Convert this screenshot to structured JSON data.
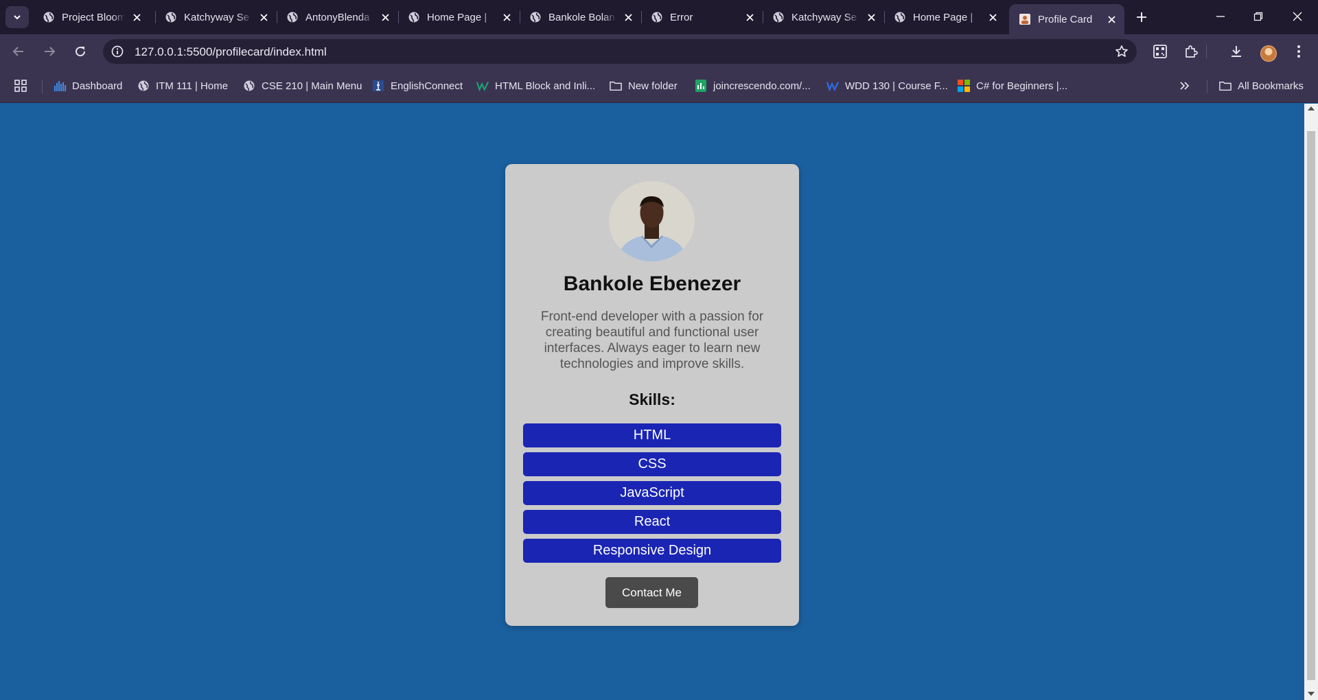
{
  "browser": {
    "tabs": [
      {
        "title": "Project Bloom",
        "active": false
      },
      {
        "title": "Katchyway Se",
        "active": false
      },
      {
        "title": "AntonyBlenda",
        "active": false
      },
      {
        "title": "Home Page |",
        "active": false
      },
      {
        "title": "Bankole Bolan",
        "active": false
      },
      {
        "title": "Error",
        "active": false
      },
      {
        "title": "Katchyway Se",
        "active": false
      },
      {
        "title": "Home Page |",
        "active": false
      },
      {
        "title": "Profile Card",
        "active": true
      }
    ],
    "url": "127.0.0.1:5500/profilecard/index.html",
    "bookmarks": [
      {
        "label": "Dashboard",
        "icon": "bar-chart-icon"
      },
      {
        "label": "ITM 111 | Home",
        "icon": "globe-icon"
      },
      {
        "label": "CSE 210 | Main Menu",
        "icon": "globe-icon"
      },
      {
        "label": "EnglishConnect",
        "icon": "church-icon"
      },
      {
        "label": "HTML Block and Inli...",
        "icon": "w-logo-icon"
      },
      {
        "label": "New folder",
        "icon": "folder-icon"
      },
      {
        "label": "joincrescendo.com/...",
        "icon": "sheets-icon"
      },
      {
        "label": "WDD 130 | Course F...",
        "icon": "w-logo-icon"
      },
      {
        "label": "C# for Beginners |...",
        "icon": "microsoft-icon"
      }
    ],
    "all_bookmarks_label": "All Bookmarks"
  },
  "profile": {
    "name": "Bankole Ebenezer",
    "bio": "Front-end developer with a passion for creating beautiful and functional user interfaces. Always eager to learn new technologies and improve skills.",
    "skills_heading": "Skills:",
    "skills": [
      "HTML",
      "CSS",
      "JavaScript",
      "React",
      "Responsive Design"
    ],
    "contact_label": "Contact Me"
  },
  "colors": {
    "page_background": "#1a5f9e",
    "card_background": "#cbcbcb",
    "skill_background": "#1a25b4",
    "button_background": "#4a4a4a"
  }
}
